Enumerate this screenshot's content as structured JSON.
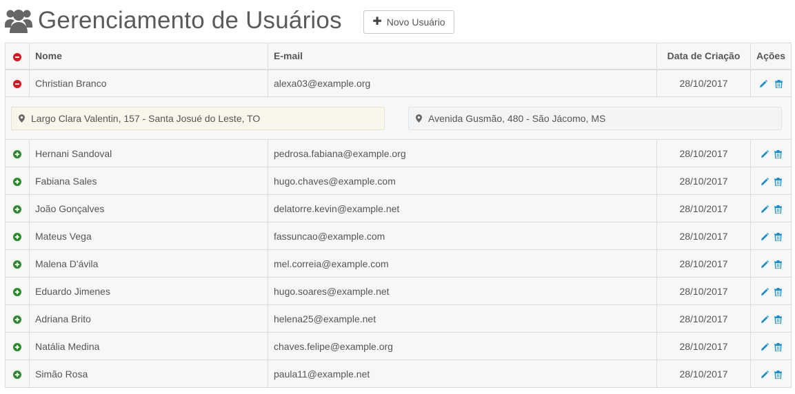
{
  "header": {
    "title": "Gerenciamento de Usuários",
    "new_user_button": "Novo Usuário",
    "new_user_icon": "plus-icon",
    "title_icon": "users-icon"
  },
  "table": {
    "columns": [
      "",
      "Nome",
      "E-mail",
      "Data de Criação",
      "Ações"
    ],
    "expanded": {
      "name": "Christian Branco",
      "email": "alexa03@example.org",
      "date": "28/10/2017",
      "addresses": [
        "Largo Clara Valentin, 157 - Santa Josué do Leste, TO",
        "Avenida Gusmão, 480 - São Jácomo, MS"
      ]
    },
    "rows": [
      {
        "name": "Hernani Sandoval",
        "email": "pedrosa.fabiana@example.org",
        "date": "28/10/2017"
      },
      {
        "name": "Fabiana Sales",
        "email": "hugo.chaves@example.com",
        "date": "28/10/2017"
      },
      {
        "name": "João Gonçalves",
        "email": "delatorre.kevin@example.net",
        "date": "28/10/2017"
      },
      {
        "name": "Mateus Vega",
        "email": "fassuncao@example.com",
        "date": "28/10/2017"
      },
      {
        "name": "Malena D'ávila",
        "email": "mel.correia@example.com",
        "date": "28/10/2017"
      },
      {
        "name": "Eduardo Jimenes",
        "email": "hugo.soares@example.net",
        "date": "28/10/2017"
      },
      {
        "name": "Adriana Brito",
        "email": "helena25@example.net",
        "date": "28/10/2017"
      },
      {
        "name": "Natália Medina",
        "email": "chaves.felipe@example.org",
        "date": "28/10/2017"
      },
      {
        "name": "Simão Rosa",
        "email": "paula11@example.net",
        "date": "28/10/2017"
      }
    ]
  },
  "colors": {
    "collapse": "#d9161f",
    "expand": "#2a8a2a",
    "action": "#1a8fd0"
  }
}
